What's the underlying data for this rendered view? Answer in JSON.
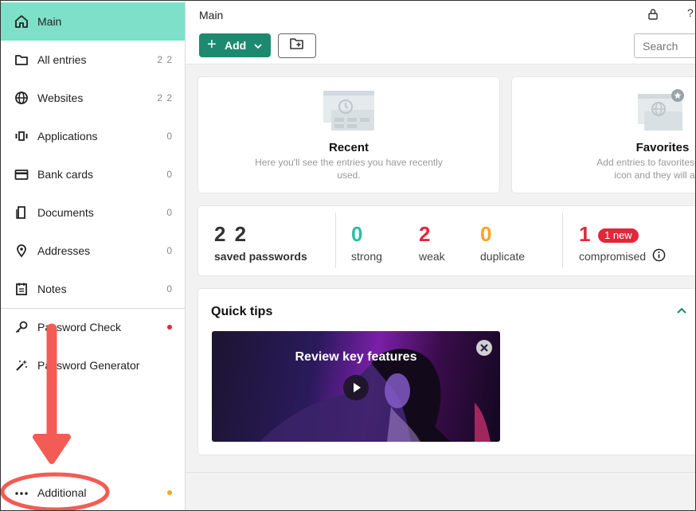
{
  "sidebar": {
    "items": [
      {
        "label": "Main",
        "count": "",
        "icon": "home-icon",
        "active": true
      },
      {
        "label": "All entries",
        "count": "2 2",
        "icon": "folder-icon"
      },
      {
        "label": "Websites",
        "count": "2 2",
        "icon": "globe-icon"
      },
      {
        "label": "Applications",
        "count": "0",
        "icon": "applications-icon"
      },
      {
        "label": "Bank cards",
        "count": "0",
        "icon": "card-icon"
      },
      {
        "label": "Documents",
        "count": "0",
        "icon": "document-icon"
      },
      {
        "label": "Addresses",
        "count": "0",
        "icon": "location-pin-icon"
      },
      {
        "label": "Notes",
        "count": "0",
        "icon": "notes-icon"
      }
    ],
    "tools": [
      {
        "label": "Password Check",
        "icon": "key-icon",
        "dot_color": "#e0283c"
      },
      {
        "label": "Password Generator",
        "icon": "magic-wand-icon"
      }
    ],
    "additional": {
      "label": "Additional",
      "icon": "more-dots-icon",
      "dot_color": "#f5a623"
    }
  },
  "header": {
    "title": "Main",
    "help": "?",
    "add_label": "Add",
    "search_placeholder": "Search"
  },
  "recent": {
    "title": "Recent",
    "desc_line1": "Here you'll see the entries you have recently",
    "desc_line2": "used."
  },
  "favorites": {
    "title": "Favorites",
    "desc_line1": "Add entries to favorites by click",
    "desc_line2": "icon and they will appe"
  },
  "stats": {
    "saved": {
      "value": "2 2",
      "label": "saved passwords"
    },
    "strong": {
      "value": "0",
      "label": "strong",
      "color": "#2bbfa4"
    },
    "weak": {
      "value": "2",
      "label": "weak",
      "color": "#e0283c"
    },
    "duplicate": {
      "value": "0",
      "label": "duplicate",
      "color": "#f5a623"
    },
    "compromised": {
      "value": "1",
      "label": "compromised",
      "badge": "1 new",
      "color": "#e0283c"
    }
  },
  "quick_tips": {
    "title": "Quick tips",
    "video_title": "Review key features"
  },
  "colors": {
    "accent": "#1d8a70",
    "active_nav": "#7ee0c8",
    "annotation": "#f25c54"
  }
}
